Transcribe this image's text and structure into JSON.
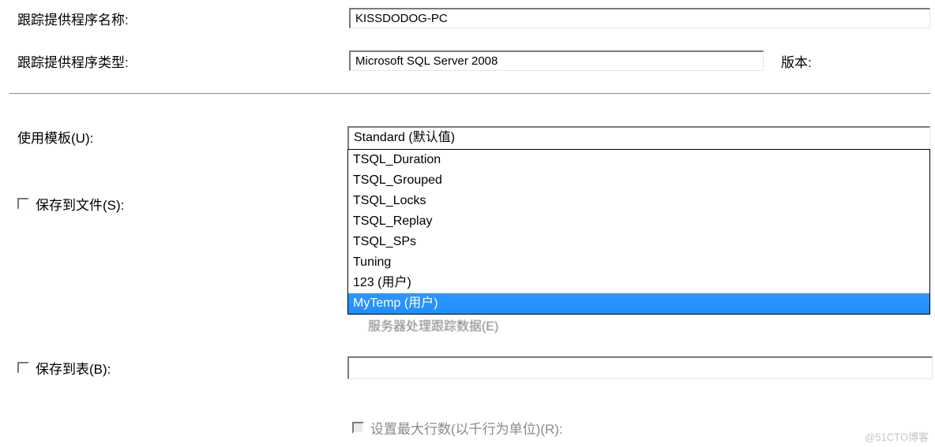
{
  "labels": {
    "provider_name": "跟踪提供程序名称:",
    "provider_type": "跟踪提供程序类型:",
    "version": "版本:",
    "use_template": "使用模板(U):",
    "save_to_file": "保存到文件(S):",
    "save_to_table": "保存到表(B):",
    "set_max_rows": "设置最大行数(以千行为单位)(R):",
    "obscured_behind": "服务器处理跟踪数据(E)"
  },
  "fields": {
    "provider_name_value": "KISSDODOG-PC",
    "provider_type_value": "Microsoft SQL Server 2008",
    "template_selected": "Standard (默认值)"
  },
  "dropdown": {
    "items": [
      "TSQL_Duration",
      "TSQL_Grouped",
      "TSQL_Locks",
      "TSQL_Replay",
      "TSQL_SPs",
      "Tuning",
      "123 (用户)",
      "MyTemp (用户)"
    ],
    "highlighted_index": 7
  },
  "watermark": "@51CTO博客"
}
